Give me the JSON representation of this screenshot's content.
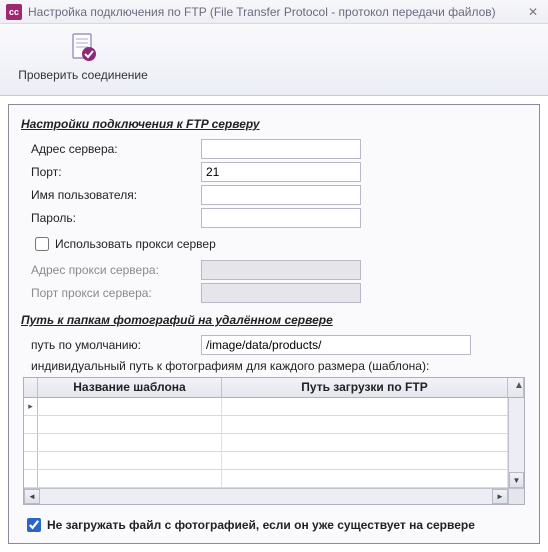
{
  "window": {
    "icon_text": "cc",
    "title": "Настройка подключения по FTP (File Transfer Protocol - протокол передачи файлов)"
  },
  "ribbon": {
    "check_connection_label": "Проверить соединение"
  },
  "ftp_section": {
    "title": "Настройки подключения к FTP серверу",
    "server_label": "Адрес сервера:",
    "server_value": "",
    "port_label": "Порт:",
    "port_value": "21",
    "user_label": "Имя пользователя:",
    "user_value": "",
    "pass_label": "Пароль:",
    "pass_value": "",
    "use_proxy_label": "Использовать прокси сервер",
    "use_proxy_checked": false,
    "proxy_addr_label": "Адрес прокси сервера:",
    "proxy_addr_value": "",
    "proxy_port_label": "Порт прокси сервера:",
    "proxy_port_value": ""
  },
  "path_section": {
    "title": "Путь к папкам фотографий на удалённом сервере",
    "default_path_label": "путь по умолчанию:",
    "default_path_value": "/image/data/products/",
    "caption": "индивидуальный путь к фотографиям для каждого размера (шаблона):",
    "col1": "Название шаблона",
    "col2": "Путь загрузки по FTP",
    "rows": [
      {
        "name": "",
        "path": ""
      },
      {
        "name": "",
        "path": ""
      },
      {
        "name": "",
        "path": ""
      },
      {
        "name": "",
        "path": ""
      },
      {
        "name": "",
        "path": ""
      }
    ]
  },
  "footer": {
    "skip_existing_label": "Не загружать файл с фотографией, если он уже существует на сервере",
    "skip_existing_checked": true
  }
}
